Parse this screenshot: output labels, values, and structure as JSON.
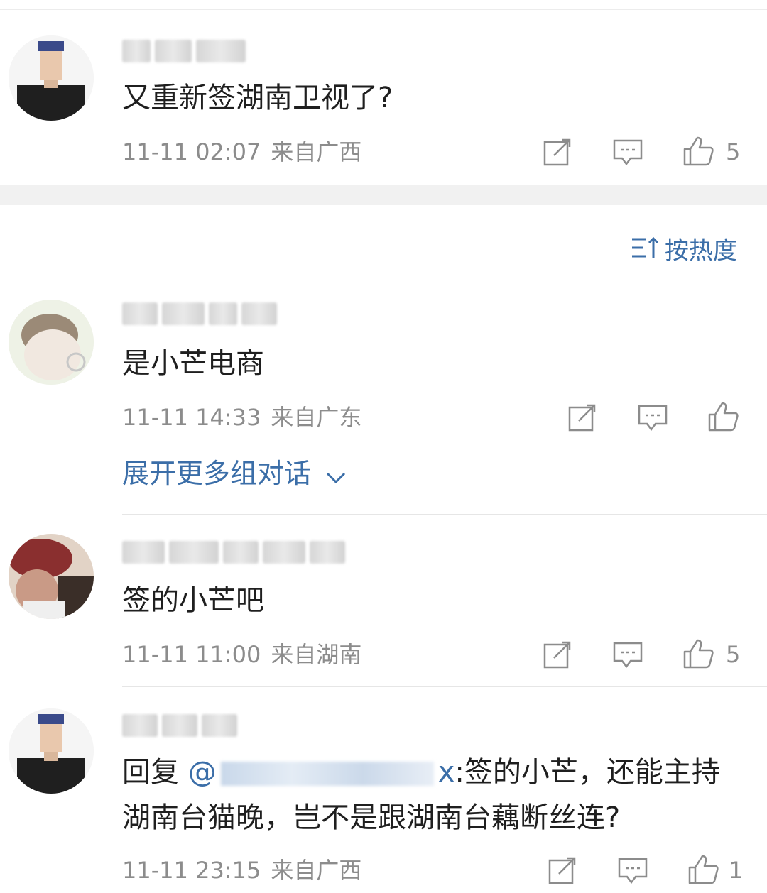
{
  "comments": [
    {
      "text": "又重新签湖南卫视了?",
      "time": "11-11 02:07",
      "location": "来自广西",
      "likes": "5"
    },
    {
      "text": "是小芒电商",
      "time": "11-11 14:33",
      "location": "来自广东",
      "likes": ""
    },
    {
      "text": "签的小芒吧",
      "time": "11-11 11:00",
      "location": "来自湖南",
      "likes": "5"
    },
    {
      "reply_prefix": "回复 ",
      "mention_start": "@",
      "mention_end": "x",
      "text_line1": ":签的小芒，还能主持",
      "text_line2": "湖南台猫晚，岂不是跟湖南台藕断丝连?",
      "time": "11-11 23:15",
      "location": "来自广西",
      "likes": "1"
    }
  ],
  "sort_label": "按热度",
  "expand_label": "展开更多组对话",
  "colors": {
    "link": "#3b6ea8",
    "meta": "#8c8c8c",
    "divider": "#f1f1f1"
  }
}
